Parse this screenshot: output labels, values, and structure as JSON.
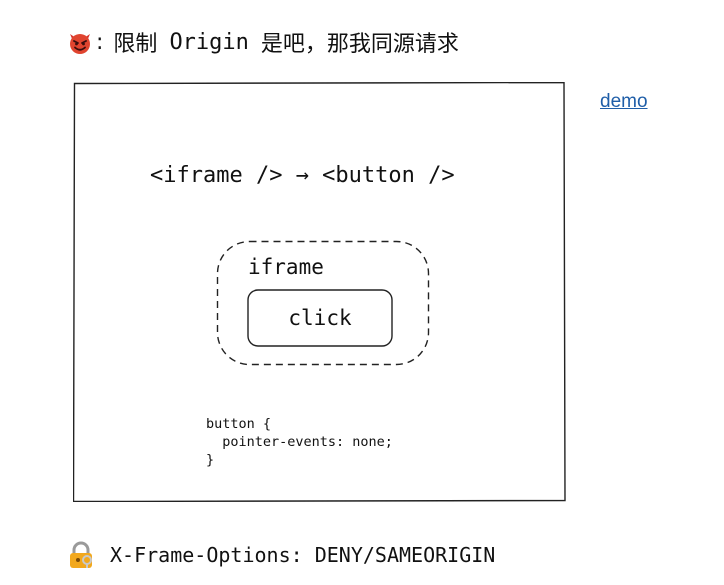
{
  "header": {
    "emoji_icon": "smiling-devil-icon",
    "prefix": ":",
    "text_before": "限制",
    "code": "Origin",
    "text_after": "是吧，那我同源请求"
  },
  "diagram": {
    "title": "<iframe /> → <button />",
    "iframe_label": "iframe",
    "button_label": "click",
    "css_code": "button {\n  pointer-events: none;\n}"
  },
  "link": {
    "label": "demo",
    "color": "#1f5ea8"
  },
  "footer": {
    "emoji_icon": "lock-with-key-icon",
    "text": "X-Frame-Options: DENY/SAMEORIGIN"
  }
}
